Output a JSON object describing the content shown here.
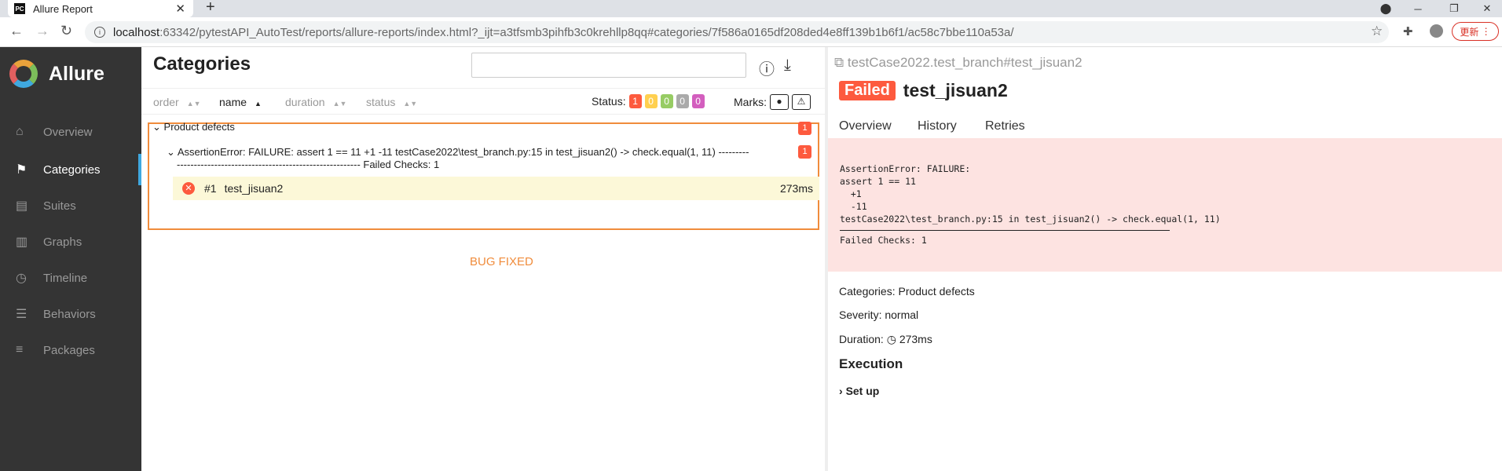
{
  "browser": {
    "tab_title": "Allure Report",
    "tab_favicon": "PC",
    "url_host": "localhost",
    "url_rest": ":63342/pytestAPI_AutoTest/reports/allure-reports/index.html?_ijt=a3tfsmb3pihfb3c0krehllp8qq#categories/7f586a0165df208ded4e8ff139b1b6f1/ac58c7bbe110a53a/",
    "update_label": "更新"
  },
  "sidebar": {
    "app_name": "Allure",
    "items": [
      {
        "label": "Overview",
        "icon": "home-icon"
      },
      {
        "label": "Categories",
        "icon": "flag-icon"
      },
      {
        "label": "Suites",
        "icon": "briefcase-icon"
      },
      {
        "label": "Graphs",
        "icon": "bar-chart-icon"
      },
      {
        "label": "Timeline",
        "icon": "clock-icon"
      },
      {
        "label": "Behaviors",
        "icon": "list-icon"
      },
      {
        "label": "Packages",
        "icon": "align-left-icon"
      }
    ]
  },
  "main": {
    "title": "Categories",
    "sort": [
      "order",
      "name",
      "duration",
      "status"
    ],
    "status_label": "Status:",
    "status_counts": [
      "1",
      "0",
      "0",
      "0",
      "0"
    ],
    "status_colors": [
      "#fd5a3e",
      "#ffd050",
      "#97cc64",
      "#aaaaaa",
      "#d35ebe"
    ],
    "marks_label": "Marks:",
    "group": {
      "name": "Product defects",
      "count": "1",
      "sub_line1": "AssertionError: FAILURE: assert 1 == 11 +1 -11 testCase2022\\test_branch.py:15 in test_jisuan2() -> check.equal(1, 11) ---------",
      "sub_line2": "------------------------------------------------------ Failed Checks: 1",
      "sub_count": "1",
      "row": {
        "num": "#1",
        "name": "test_jisuan2",
        "duration": "273ms"
      }
    },
    "annotation": "BUG FIXED"
  },
  "pane": {
    "breadcrumb": "testCase2022.test_branch#test_jisuan2",
    "status": "Failed",
    "name": "test_jisuan2",
    "tabs": [
      "Overview",
      "History",
      "Retries"
    ],
    "error": "AssertionError: FAILURE:\nassert 1 == 11\n  +1\n  -11\ntestCase2022\\test_branch.py:15 in test_jisuan2() -> check.equal(1, 11)",
    "error_tail": "Failed Checks: 1",
    "categories": "Categories: Product defects",
    "severity": "Severity: normal",
    "duration_label": "Duration:",
    "duration": "273ms",
    "execution": "Execution",
    "setup": "Set up"
  }
}
